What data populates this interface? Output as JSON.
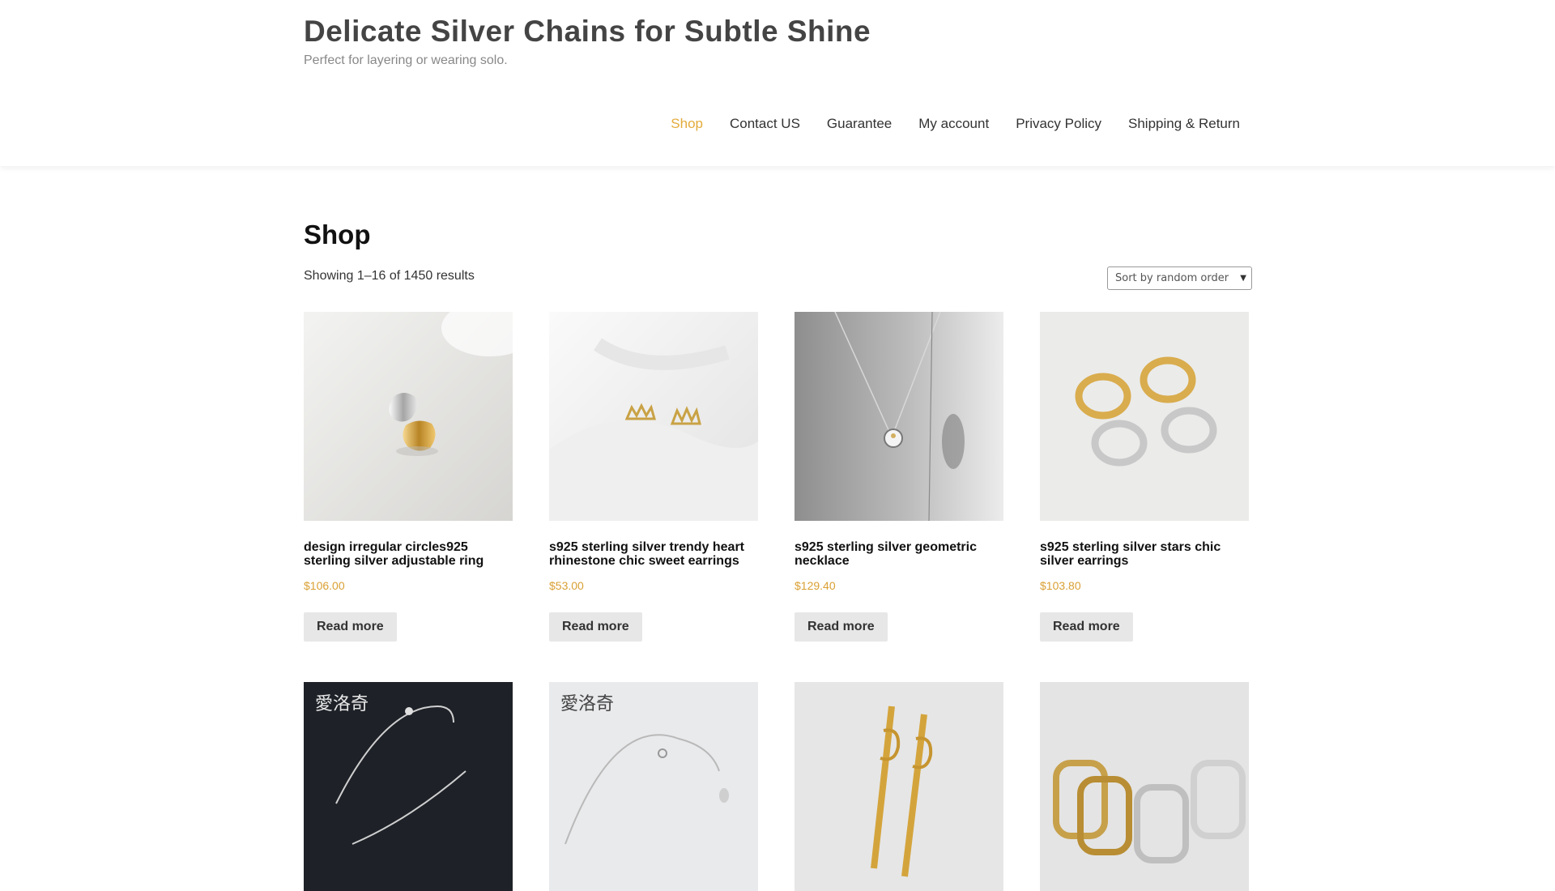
{
  "site": {
    "title": "Delicate Silver Chains for Subtle Shine",
    "tagline": "Perfect for layering or wearing solo."
  },
  "nav": [
    {
      "label": "Shop",
      "active": true
    },
    {
      "label": "Contact US"
    },
    {
      "label": "Guarantee"
    },
    {
      "label": "My account"
    },
    {
      "label": "Privacy Policy"
    },
    {
      "label": "Shipping & Return"
    }
  ],
  "page": {
    "title": "Shop",
    "result_count": "Showing 1–16 of 1450 results",
    "ordering": "Sort by random order"
  },
  "products": [
    {
      "name": "design irregular circles925 sterling silver adjustable ring",
      "price": "$106.00",
      "button": "Read more"
    },
    {
      "name": "s925 sterling silver trendy heart rhinestone chic sweet earrings",
      "price": "$53.00",
      "button": "Read more"
    },
    {
      "name": "s925 sterling silver geometric necklace",
      "price": "$129.40",
      "button": "Read more"
    },
    {
      "name": "s925 sterling silver stars chic silver earrings",
      "price": "$103.80",
      "button": "Read more"
    },
    {
      "name": "",
      "price": "",
      "button": "",
      "image_text": "愛洛奇"
    },
    {
      "name": "",
      "price": "",
      "button": "",
      "image_text": "愛洛奇"
    },
    {
      "name": "",
      "price": "",
      "button": ""
    },
    {
      "name": "",
      "price": "",
      "button": ""
    }
  ],
  "colors": {
    "accent": "#e4ab3b",
    "price": "#d9a034",
    "button_bg": "#e7e7e7"
  }
}
